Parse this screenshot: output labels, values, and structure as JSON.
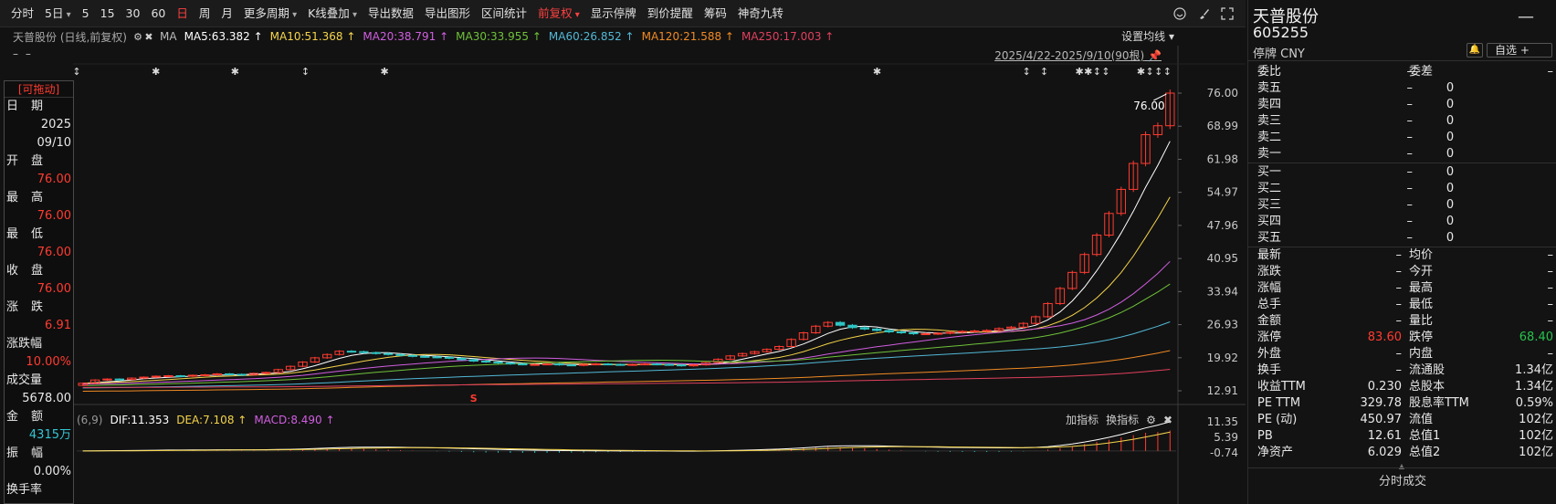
{
  "toolbar": {
    "items": [
      {
        "label": "分时",
        "active": false,
        "dropdown": false
      },
      {
        "label": "5日",
        "active": false,
        "dropdown": true
      },
      {
        "label": "5",
        "active": false,
        "dropdown": false
      },
      {
        "label": "15",
        "active": false,
        "dropdown": false
      },
      {
        "label": "30",
        "active": false,
        "dropdown": false
      },
      {
        "label": "60",
        "active": false,
        "dropdown": false
      },
      {
        "label": "日",
        "active": true,
        "dropdown": false
      },
      {
        "label": "周",
        "active": false,
        "dropdown": false
      },
      {
        "label": "月",
        "active": false,
        "dropdown": false
      },
      {
        "label": "更多周期",
        "active": false,
        "dropdown": true
      },
      {
        "label": "K线叠加",
        "active": false,
        "dropdown": true
      },
      {
        "label": "导出数据",
        "active": false,
        "dropdown": false
      },
      {
        "label": "导出图形",
        "active": false,
        "dropdown": false
      },
      {
        "label": "区间统计",
        "active": false,
        "dropdown": false
      },
      {
        "label": "前复权",
        "active": true,
        "dropdown": true
      },
      {
        "label": "显示停牌",
        "active": false,
        "dropdown": false
      },
      {
        "label": "到价提醒",
        "active": false,
        "dropdown": false
      },
      {
        "label": "筹码",
        "active": false,
        "dropdown": false
      },
      {
        "label": "神奇九转",
        "active": false,
        "dropdown": false
      }
    ],
    "icons": [
      "smiley-icon",
      "brush-icon",
      "fullscreen-icon"
    ]
  },
  "ma_bar": {
    "stock_label": "天普股份 (日线,前复权)",
    "ma_title": "MA",
    "items": [
      {
        "text": "MA5:63.382 ↑",
        "color": "#ffffff"
      },
      {
        "text": "MA10:51.368 ↑",
        "color": "#f5d44a"
      },
      {
        "text": "MA20:38.791 ↑",
        "color": "#d05ee0"
      },
      {
        "text": "MA30:33.955 ↑",
        "color": "#6fc23a"
      },
      {
        "text": "MA60:26.852 ↑",
        "color": "#52b8d6"
      },
      {
        "text": "MA120:21.588 ↑",
        "color": "#f08a24"
      },
      {
        "text": "MA250:17.003 ↑",
        "color": "#e0405e"
      }
    ],
    "settings_label": "设置均线",
    "dashes": "– –",
    "range_label": "2025/4/22-2025/9/10(90根)"
  },
  "info_panel": {
    "drag_label": "[可拖动]",
    "rows": [
      {
        "label": "日期",
        "tight": false
      },
      {
        "value": "2025",
        "cls": ""
      },
      {
        "value": "09/10",
        "cls": ""
      },
      {
        "label": "开盘",
        "tight": false
      },
      {
        "value": "76.00",
        "cls": "red"
      },
      {
        "label": "最高",
        "tight": false
      },
      {
        "value": "76.00",
        "cls": "red"
      },
      {
        "label": "最低",
        "tight": false
      },
      {
        "value": "76.00",
        "cls": "red"
      },
      {
        "label": "收盘",
        "tight": false
      },
      {
        "value": "76.00",
        "cls": "red"
      },
      {
        "label": "涨跌",
        "tight": false
      },
      {
        "value": "6.91",
        "cls": "red"
      },
      {
        "label": "涨跌幅",
        "tight": true
      },
      {
        "value": "10.00%",
        "cls": "red"
      },
      {
        "label": "成交量",
        "tight": true
      },
      {
        "value": "5678.00",
        "cls": ""
      },
      {
        "label": "金额",
        "tight": false
      },
      {
        "value": "4315万",
        "cls": "cyan"
      },
      {
        "label": "振幅",
        "tight": false
      },
      {
        "value": "0.00%",
        "cls": ""
      },
      {
        "label": "换手率",
        "tight": true
      }
    ]
  },
  "price_axis": {
    "ticks": [
      "76.00",
      "68.99",
      "61.98",
      "54.97",
      "47.96",
      "40.95",
      "33.94",
      "26.93",
      "19.92",
      "12.91"
    ],
    "last_price_label": "76.00",
    "signal_marker": "S"
  },
  "macd": {
    "param": "(6,9)",
    "items": [
      {
        "text": "DIF:11.353",
        "color": "#ffffff"
      },
      {
        "text": "DEA:7.108 ↑",
        "color": "#f5d44a"
      },
      {
        "text": "MACD:8.490 ↑",
        "color": "#d05ee0"
      }
    ],
    "ticks": [
      "11.35",
      "5.39",
      "-0.74"
    ],
    "tools": [
      "加指标",
      "换指标"
    ]
  },
  "chart_data": {
    "type": "candlestick",
    "title": "天普股份 (日线,前复权)",
    "period": "2025/4/22-2025/9/10",
    "bars": 90,
    "ylim": [
      12.91,
      76.0
    ],
    "last_close": 76.0,
    "closes": [
      14.5,
      15.2,
      15.4,
      15.3,
      15.6,
      15.8,
      16.0,
      16.1,
      16.0,
      16.2,
      16.3,
      16.5,
      16.4,
      16.3,
      16.6,
      16.8,
      17.4,
      18.1,
      19.0,
      19.9,
      20.6,
      21.3,
      21.2,
      21.0,
      20.8,
      20.6,
      20.4,
      20.2,
      20.1,
      20.0,
      19.8,
      19.5,
      19.2,
      19.0,
      18.8,
      18.6,
      18.5,
      18.5,
      18.6,
      18.4,
      18.3,
      18.5,
      18.6,
      18.5,
      18.4,
      18.5,
      18.6,
      18.5,
      18.4,
      18.2,
      18.4,
      18.9,
      19.6,
      20.3,
      20.8,
      21.2,
      21.7,
      22.3,
      23.8,
      25.2,
      26.6,
      27.4,
      26.8,
      26.3,
      26.0,
      25.7,
      25.4,
      25.2,
      25.0,
      25.0,
      25.1,
      25.3,
      25.5,
      25.6,
      25.7,
      26.1,
      26.4,
      27.2,
      28.6,
      31.4,
      34.6,
      38.0,
      41.8,
      45.9,
      50.5,
      55.6,
      61.1,
      67.2,
      69.09,
      76.0
    ],
    "ma_last": {
      "MA5": 63.382,
      "MA10": 51.368,
      "MA20": 38.791,
      "MA30": 33.955,
      "MA60": 26.852,
      "MA120": 21.588,
      "MA250": 17.003
    },
    "macd_last": {
      "DIF": 11.353,
      "DEA": 7.108,
      "MACD": 8.49
    },
    "macd_ylim": [
      -0.74,
      11.35
    ]
  },
  "right_panel": {
    "name": "天普股份",
    "code": "605255",
    "status": "停牌 CNY",
    "zixuan_label": "自选 +",
    "weibi_row": {
      "l1": "委比",
      "v1": "–",
      "l2": "委差",
      "v2": "–"
    },
    "asks": [
      {
        "label": "卖五",
        "price": "–",
        "vol": "0"
      },
      {
        "label": "卖四",
        "price": "–",
        "vol": "0"
      },
      {
        "label": "卖三",
        "price": "–",
        "vol": "0"
      },
      {
        "label": "卖二",
        "price": "–",
        "vol": "0"
      },
      {
        "label": "卖一",
        "price": "–",
        "vol": "0"
      }
    ],
    "bids": [
      {
        "label": "买一",
        "price": "–",
        "vol": "0"
      },
      {
        "label": "买二",
        "price": "–",
        "vol": "0"
      },
      {
        "label": "买三",
        "price": "–",
        "vol": "0"
      },
      {
        "label": "买四",
        "price": "–",
        "vol": "0"
      },
      {
        "label": "买五",
        "price": "–",
        "vol": "0"
      }
    ],
    "quotes": [
      {
        "l1": "最新",
        "v1": "–",
        "c1": "",
        "l2": "均价",
        "v2": "–",
        "c2": ""
      },
      {
        "l1": "涨跌",
        "v1": "–",
        "c1": "",
        "l2": "今开",
        "v2": "–",
        "c2": ""
      },
      {
        "l1": "涨幅",
        "v1": "–",
        "c1": "",
        "l2": "最高",
        "v2": "–",
        "c2": ""
      },
      {
        "l1": "总手",
        "v1": "–",
        "c1": "",
        "l2": "最低",
        "v2": "–",
        "c2": ""
      },
      {
        "l1": "金额",
        "v1": "–",
        "c1": "",
        "l2": "量比",
        "v2": "–",
        "c2": ""
      },
      {
        "l1": "涨停",
        "v1": "83.60",
        "c1": "red",
        "l2": "跌停",
        "v2": "68.40",
        "c2": "green"
      },
      {
        "l1": "外盘",
        "v1": "–",
        "c1": "",
        "l2": "内盘",
        "v2": "–",
        "c2": ""
      },
      {
        "l1": "换手",
        "v1": "–",
        "c1": "",
        "l2": "流通股",
        "v2": "1.34亿",
        "c2": ""
      },
      {
        "l1": "收益TTM",
        "v1": "0.230",
        "c1": "",
        "l2": "总股本",
        "v2": "1.34亿",
        "c2": ""
      },
      {
        "l1": "PE TTM",
        "v1": "329.78",
        "c1": "",
        "l2": "股息率TTM",
        "v2": "0.59%",
        "c2": ""
      },
      {
        "l1": "PE (动)",
        "v1": "450.97",
        "c1": "",
        "l2": "流值",
        "v2": "102亿",
        "c2": ""
      },
      {
        "l1": "PB",
        "v1": "12.61",
        "c1": "",
        "l2": "总值1",
        "v2": "102亿",
        "c2": ""
      },
      {
        "l1": "净资产",
        "v1": "6.029",
        "c1": "",
        "l2": "总值2",
        "v2": "102亿",
        "c2": ""
      }
    ],
    "bottom_label": "分时成交"
  }
}
